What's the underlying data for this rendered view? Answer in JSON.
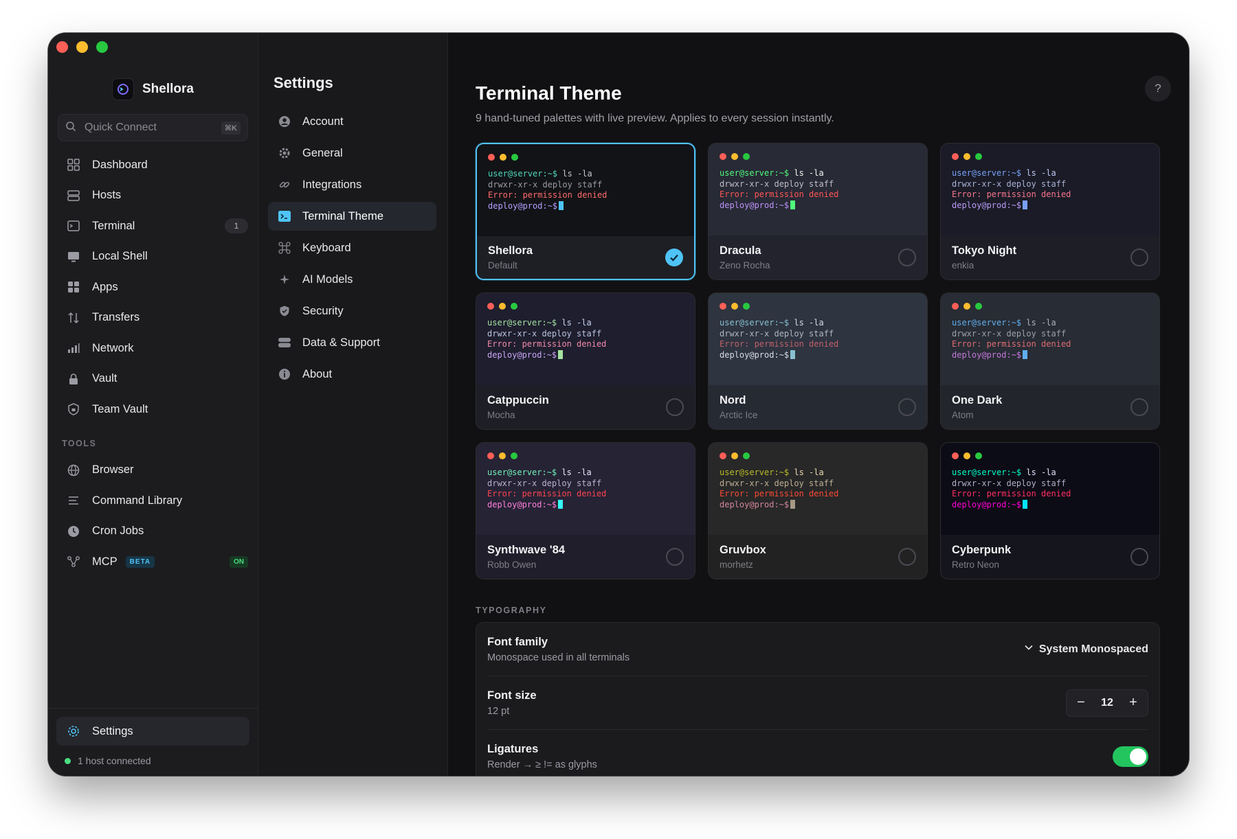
{
  "app": {
    "name": "Shellora"
  },
  "search": {
    "placeholder": "Quick Connect",
    "shortcut": "⌘K"
  },
  "sidebar": {
    "items": [
      {
        "name": "dashboard",
        "label": "Dashboard",
        "icon": "grid-icon"
      },
      {
        "name": "hosts",
        "label": "Hosts",
        "icon": "server-icon"
      },
      {
        "name": "terminal",
        "label": "Terminal",
        "icon": "terminal-icon",
        "badge": "1"
      },
      {
        "name": "local-shell",
        "label": "Local Shell",
        "icon": "monitor-icon"
      },
      {
        "name": "apps",
        "label": "Apps",
        "icon": "apps-icon"
      },
      {
        "name": "transfers",
        "label": "Transfers",
        "icon": "transfer-icon"
      },
      {
        "name": "network",
        "label": "Network",
        "icon": "bars-icon"
      },
      {
        "name": "vault",
        "label": "Vault",
        "icon": "lock-icon"
      },
      {
        "name": "team-vault",
        "label": "Team Vault",
        "icon": "shield-lock-icon"
      }
    ],
    "tools_label": "TOOLS",
    "tools": [
      {
        "name": "browser",
        "label": "Browser",
        "icon": "globe-icon"
      },
      {
        "name": "command-library",
        "label": "Command Library",
        "icon": "list-icon"
      },
      {
        "name": "cron-jobs",
        "label": "Cron Jobs",
        "icon": "clock-icon"
      },
      {
        "name": "mcp",
        "label": "MCP",
        "icon": "nodes-icon",
        "beta": "BETA",
        "status": "ON"
      }
    ],
    "settings_label": "Settings",
    "status_text": "1 host connected"
  },
  "settings": {
    "title": "Settings",
    "items": [
      {
        "name": "account",
        "label": "Account",
        "icon": "user-icon"
      },
      {
        "name": "general",
        "label": "General",
        "icon": "gear-icon"
      },
      {
        "name": "integrations",
        "label": "Integrations",
        "icon": "link-icon"
      },
      {
        "name": "terminal-theme",
        "label": "Terminal Theme",
        "icon": "terminal-theme-icon",
        "active": true
      },
      {
        "name": "keyboard",
        "label": "Keyboard",
        "icon": "command-icon"
      },
      {
        "name": "ai-models",
        "label": "AI Models",
        "icon": "sparkle-icon"
      },
      {
        "name": "security",
        "label": "Security",
        "icon": "shield-check-icon"
      },
      {
        "name": "data-support",
        "label": "Data & Support",
        "icon": "database-icon"
      },
      {
        "name": "about",
        "label": "About",
        "icon": "info-icon"
      }
    ]
  },
  "main": {
    "title": "Terminal Theme",
    "subtitle": "9 hand-tuned palettes with live preview. Applies to every session instantly.",
    "help": "?",
    "preview_lines": {
      "prompt": "user@server:~$",
      "command": " ls -la",
      "output": "drwxr-xr-x deploy staff",
      "error": "Error: permission denied",
      "prompt2": "deploy@prod:~$"
    },
    "themes": [
      {
        "name": "Shellora",
        "author": "Default",
        "selected": true,
        "colors": {
          "bg": "#121316",
          "prompt": "#4fd6be",
          "text": "#c8c8d0",
          "out": "#9a9aa4",
          "err": "#ff6b6b",
          "prompt2": "#b4a0ff",
          "cursor": "#4fc3f7",
          "foot": "#1e1f24"
        }
      },
      {
        "name": "Dracula",
        "author": "Zeno Rocha",
        "selected": false,
        "colors": {
          "bg": "#282a36",
          "prompt": "#50fa7b",
          "text": "#f8f8f2",
          "out": "#bdbdc8",
          "err": "#ff5555",
          "prompt2": "#bd93f9",
          "cursor": "#50fa7b",
          "foot": "#22232d"
        }
      },
      {
        "name": "Tokyo Night",
        "author": "enkia",
        "selected": false,
        "colors": {
          "bg": "#1a1b26",
          "prompt": "#7aa2f7",
          "text": "#c0caf5",
          "out": "#a9b1d6",
          "err": "#f7768e",
          "prompt2": "#bb9af7",
          "cursor": "#7aa2f7",
          "foot": "#1d1e26"
        }
      },
      {
        "name": "Catppuccin",
        "author": "Mocha",
        "selected": false,
        "colors": {
          "bg": "#1e1e2e",
          "prompt": "#a6e3a1",
          "text": "#cdd6f4",
          "out": "#bac2de",
          "err": "#f38ba8",
          "prompt2": "#cba6f7",
          "cursor": "#a6e3a1",
          "foot": "#1e1e26"
        }
      },
      {
        "name": "Nord",
        "author": "Arctic Ice",
        "selected": false,
        "colors": {
          "bg": "#2e3440",
          "prompt": "#88c0d0",
          "text": "#d8dee9",
          "out": "#aeb6c4",
          "err": "#bf616a",
          "prompt2": "#d8dee9",
          "cursor": "#88c0d0",
          "foot": "#262a33"
        }
      },
      {
        "name": "One Dark",
        "author": "Atom",
        "selected": false,
        "colors": {
          "bg": "#282c34",
          "prompt": "#61afef",
          "text": "#abb2bf",
          "out": "#9aa1ad",
          "err": "#e06c75",
          "prompt2": "#c678dd",
          "cursor": "#61afef",
          "foot": "#22252c"
        }
      },
      {
        "name": "Synthwave '84",
        "author": "Robb Owen",
        "selected": false,
        "colors": {
          "bg": "#262335",
          "prompt": "#72f1b8",
          "text": "#f0e6ff",
          "out": "#bbb0cc",
          "err": "#fe4450",
          "prompt2": "#ff7edb",
          "cursor": "#36f9f6",
          "foot": "#201e2b"
        }
      },
      {
        "name": "Gruvbox",
        "author": "morhetz",
        "selected": false,
        "colors": {
          "bg": "#282828",
          "prompt": "#b8bb26",
          "text": "#ebdbb2",
          "out": "#bdae93",
          "err": "#fb4934",
          "prompt2": "#d3869b",
          "cursor": "#a89984",
          "foot": "#222222"
        }
      },
      {
        "name": "Cyberpunk",
        "author": "Retro Neon",
        "selected": false,
        "colors": {
          "bg": "#0c0c16",
          "prompt": "#00ffc8",
          "text": "#e0e0ff",
          "out": "#b0b0c8",
          "err": "#ff2e63",
          "prompt2": "#ff00d4",
          "cursor": "#00e5ff",
          "foot": "#15151d"
        }
      }
    ]
  },
  "typography": {
    "section_label": "TYPOGRAPHY",
    "font_family": {
      "title": "Font family",
      "subtitle": "Monospace used in all terminals",
      "value": "System Monospaced"
    },
    "font_size": {
      "title": "Font size",
      "subtitle": "12 pt",
      "value": "12",
      "minus": "−",
      "plus": "+"
    },
    "ligatures": {
      "title": "Ligatures",
      "subtitle": "Render → ≥ != as glyphs",
      "enabled": true
    }
  },
  "colors": {
    "accent": "#4fc3f7",
    "toggle_on": "#22c55e",
    "status_ok": "#4ade80"
  }
}
